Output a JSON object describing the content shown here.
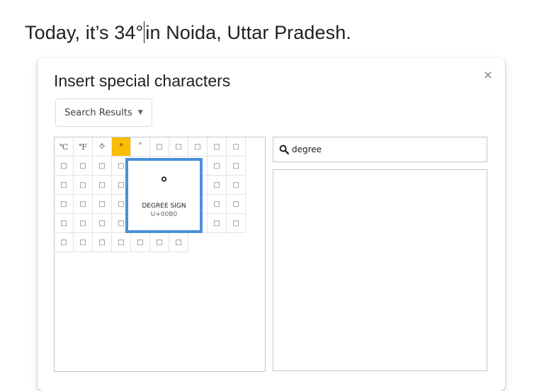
{
  "document": {
    "text_before_caret": "Today, it’s 34°",
    "text_after_caret": "in Noida, Uttar Pradesh."
  },
  "dialog": {
    "title": "Insert special characters",
    "close_label": "×",
    "category_dropdown": "Search Results",
    "search": {
      "value": "degree",
      "icon": "search-icon"
    },
    "grid": {
      "columns": 10,
      "characters": [
        "℃",
        "℉",
        "⯑",
        "°",
        "˚",
        "□",
        "□",
        "□",
        "□",
        "□",
        "□",
        "□",
        "□",
        "□",
        "□",
        "□",
        "□",
        "□",
        "□",
        "□",
        "□",
        "□",
        "□",
        "□",
        "□",
        "□",
        "□",
        "□",
        "□",
        "□",
        "□",
        "□",
        "□",
        "□",
        "□",
        "□",
        "□",
        "□",
        "□",
        "□",
        "□",
        "□",
        "□",
        "□",
        "□",
        "□",
        "□",
        "□",
        "□",
        "□",
        "□",
        "□",
        "□",
        "□",
        "□",
        "□",
        "□"
      ],
      "selected_index": 3
    },
    "tooltip": {
      "glyph": "°",
      "name": "DEGREE SIGN",
      "code": "U+00B0"
    }
  },
  "colors": {
    "selected_cell": "#fbbc04",
    "tooltip_border": "#4a90d9"
  }
}
